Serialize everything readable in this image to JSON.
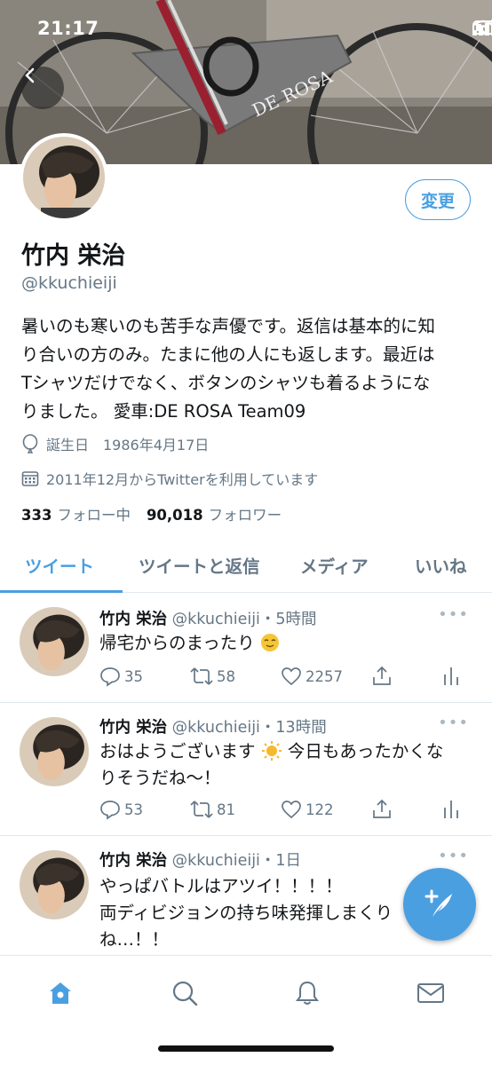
{
  "status_bar": {
    "time": "21:17"
  },
  "profile": {
    "name": "竹内 栄治",
    "handle": "@kkuchieiji",
    "edit_label": "変更",
    "bio_lines": [
      "暑いのも寒いのも苦手な声優です。返信は基本的に知",
      "り合いの方のみ。たまに他の人にも返します。最近は",
      "Tシャツだけでなく、ボタンのシャツも着るようにな",
      "りました。 愛車:DE ROSA Team09"
    ],
    "birthday": "誕生日　1986年4月17日",
    "joined": "2011年12月からTwitterを利用しています",
    "following_count": "333",
    "following_label": "フォロー中",
    "followers_count": "90,018",
    "followers_label": "フォロワー"
  },
  "tabs": [
    "ツイート",
    "ツイートと返信",
    "メディア",
    "いいね"
  ],
  "tweets": [
    {
      "name": "竹内 栄治",
      "handle": "@kkuchieiji",
      "time": "5時間",
      "lines": [
        "帰宅からのまったり"
      ],
      "replies": "35",
      "retweets": "58",
      "likes": "2257"
    },
    {
      "name": "竹内 栄治",
      "handle": "@kkuchieiji",
      "time": "13時間",
      "lines": [
        "おはようございます",
        "今日もあったかくな",
        "りそうだね〜！"
      ],
      "replies": "53",
      "retweets": "81",
      "likes": "122"
    },
    {
      "name": "竹内 栄治",
      "handle": "@kkuchieiji",
      "time": "1日",
      "lines": [
        "やっぱバトルはアツイ！！！！",
        "両ディビジョンの持ち味発揮しまくり",
        "ね…！！"
      ]
    }
  ],
  "icons": {
    "back": "chevron-left-icon",
    "home": "home-icon",
    "search": "search-icon",
    "notifications": "bell-icon",
    "messages": "mail-icon",
    "compose": "compose-tweet-icon"
  },
  "colors": {
    "accent": "#4a9fe0",
    "secondary_text": "#657786"
  }
}
